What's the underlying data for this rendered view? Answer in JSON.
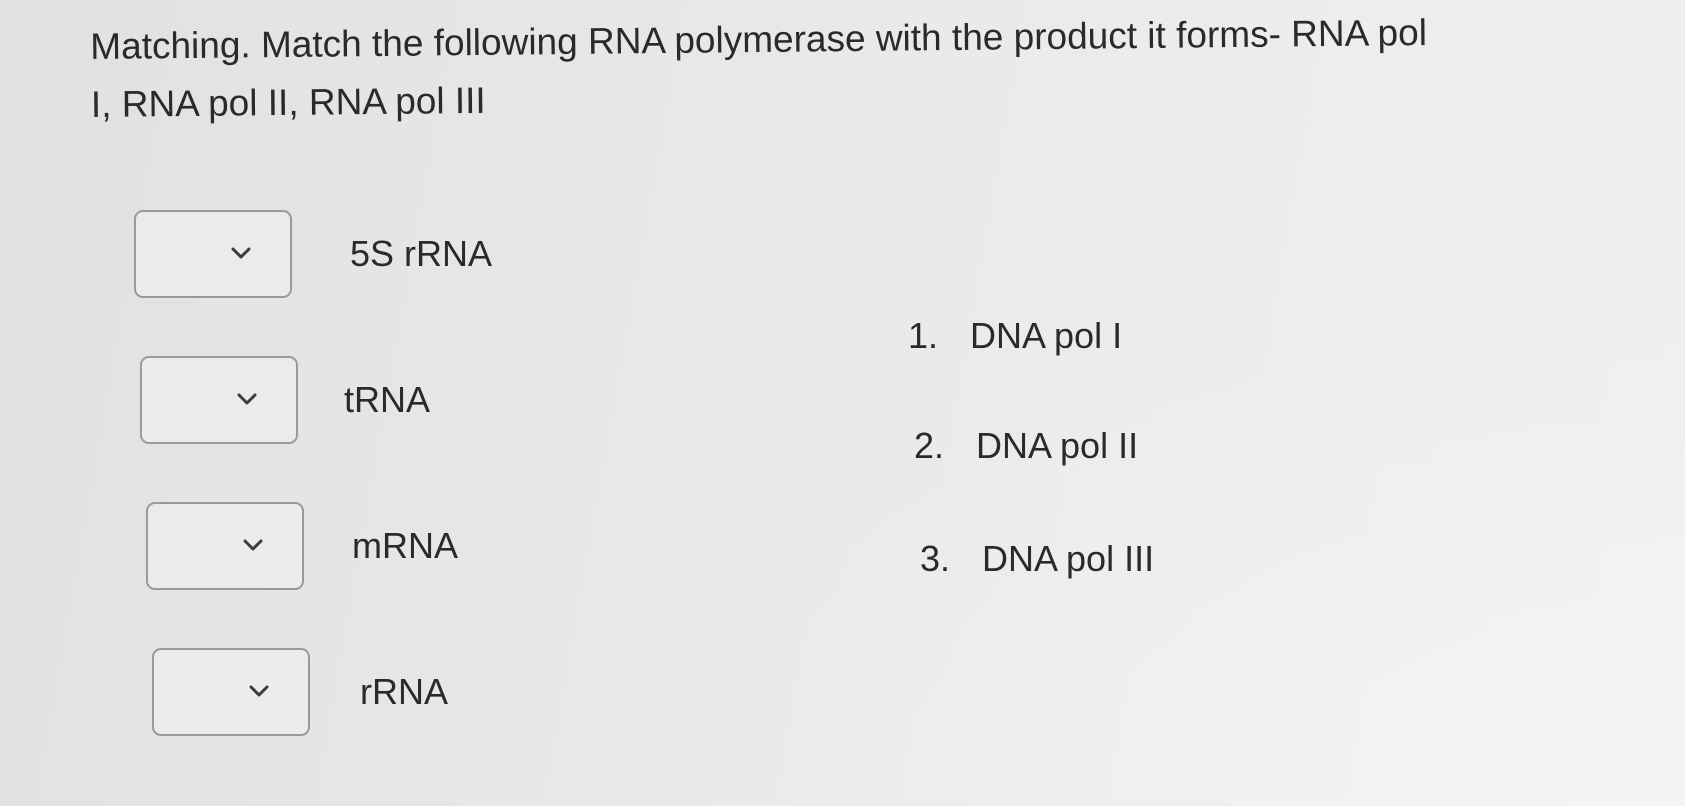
{
  "question": {
    "line1": "Matching. Match the following RNA polymerase with the product it forms- RNA pol",
    "line2": "I, RNA pol II, RNA pol III"
  },
  "match_items": [
    {
      "label": "5S rRNA",
      "selected": ""
    },
    {
      "label": "tRNA",
      "selected": ""
    },
    {
      "label": "mRNA",
      "selected": ""
    },
    {
      "label": "rRNA",
      "selected": ""
    }
  ],
  "options": [
    {
      "number": "1.",
      "text": "DNA pol I"
    },
    {
      "number": "2.",
      "text": "DNA pol II"
    },
    {
      "number": "3.",
      "text": "DNA pol III"
    }
  ],
  "icons": {
    "dropdown": "chevron-down-icon"
  }
}
